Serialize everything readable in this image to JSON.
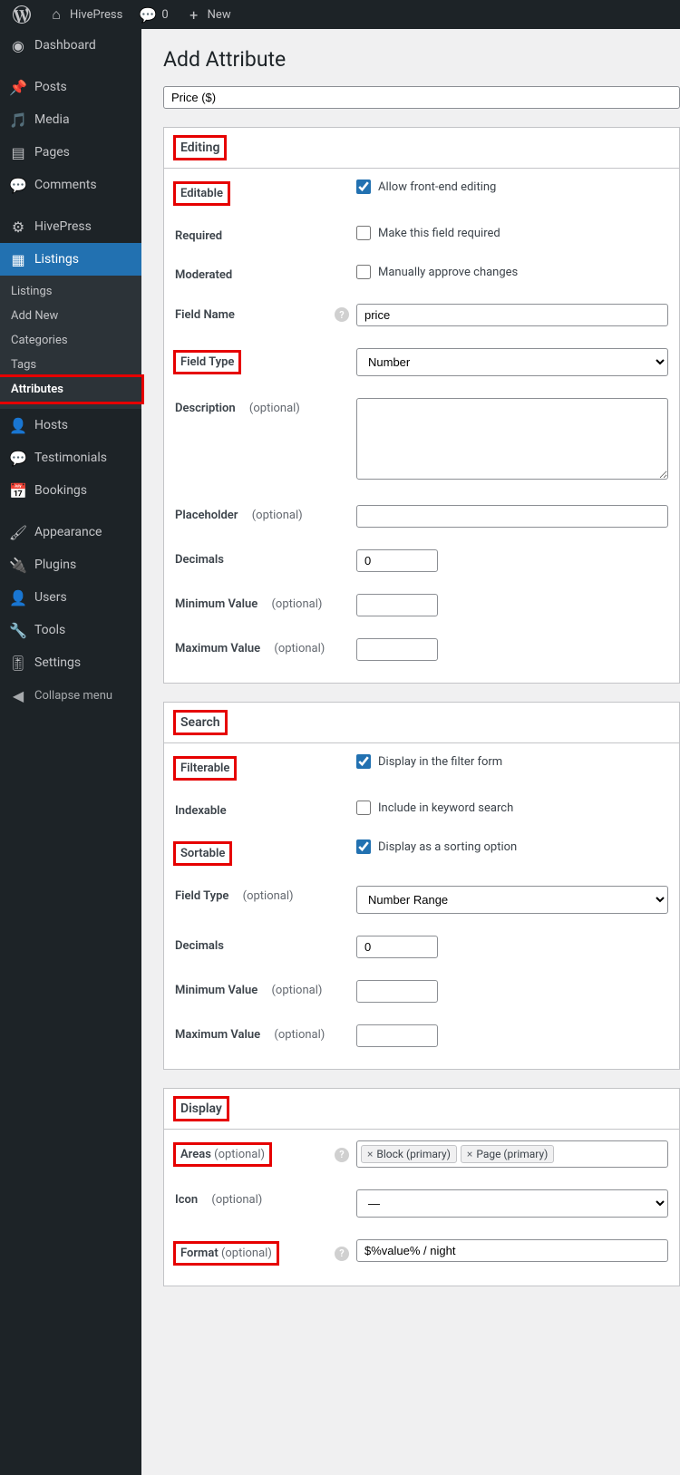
{
  "toolbar": {
    "site_name": "HivePress",
    "comments_count": "0",
    "new_label": "New"
  },
  "sidebar": {
    "dashboard": "Dashboard",
    "posts": "Posts",
    "media": "Media",
    "pages": "Pages",
    "comments": "Comments",
    "hivepress": "HivePress",
    "listings": "Listings",
    "listings_sub": [
      "Listings",
      "Add New",
      "Categories",
      "Tags",
      "Attributes"
    ],
    "hosts": "Hosts",
    "testimonials": "Testimonials",
    "bookings": "Bookings",
    "appearance": "Appearance",
    "plugins": "Plugins",
    "users": "Users",
    "tools": "Tools",
    "settings": "Settings",
    "collapse": "Collapse menu"
  },
  "page": {
    "heading": "Add Attribute",
    "title_value": "Price ($)"
  },
  "editing": {
    "section": "Editing",
    "editable_label": "Editable",
    "editable_text": "Allow front-end editing",
    "required_label": "Required",
    "required_text": "Make this field required",
    "moderated_label": "Moderated",
    "moderated_text": "Manually approve changes",
    "field_name_label": "Field Name",
    "field_name_value": "price",
    "field_type_label": "Field Type",
    "field_type_value": "Number",
    "description_label": "Description",
    "placeholder_label": "Placeholder",
    "decimals_label": "Decimals",
    "decimals_value": "0",
    "min_label": "Minimum Value",
    "max_label": "Maximum Value",
    "optional": "(optional)"
  },
  "search": {
    "section": "Search",
    "filterable_label": "Filterable",
    "filterable_text": "Display in the filter form",
    "indexable_label": "Indexable",
    "indexable_text": "Include in keyword search",
    "sortable_label": "Sortable",
    "sortable_text": "Display as a sorting option",
    "field_type_label": "Field Type",
    "field_type_value": "Number Range",
    "decimals_label": "Decimals",
    "decimals_value": "0",
    "min_label": "Minimum Value",
    "max_label": "Maximum Value",
    "optional": "(optional)"
  },
  "display": {
    "section": "Display",
    "areas_label": "Areas",
    "areas_tags": [
      "Block (primary)",
      "Page (primary)"
    ],
    "icon_label": "Icon",
    "icon_value": "—",
    "format_label": "Format",
    "format_value": "$%value% / night",
    "optional": "(optional)"
  }
}
